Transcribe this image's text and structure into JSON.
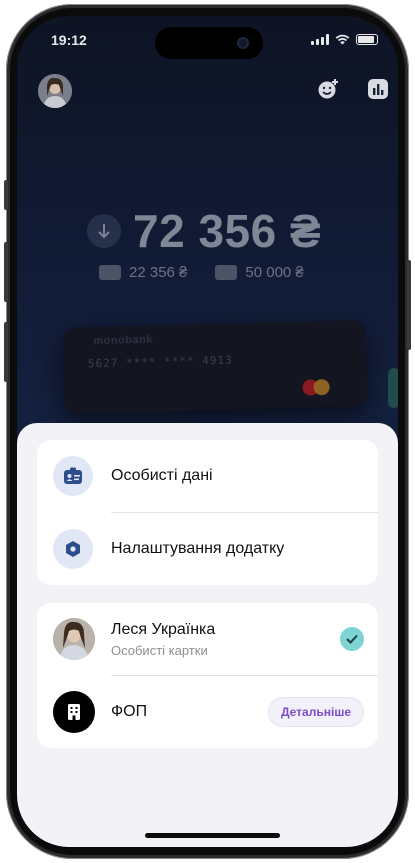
{
  "status_bar": {
    "time": "19:12"
  },
  "balance": {
    "amount": "72 356 ₴",
    "own_funds": "22 356 ₴",
    "credit_limit": "50 000 ₴"
  },
  "card": {
    "brand": "monobank",
    "number": "5627  ****  ****  4913"
  },
  "menu": {
    "personal_data": "Особисті дані",
    "app_settings": "Налаштування додатку"
  },
  "accounts": [
    {
      "name": "Леся Українка",
      "subtitle": "Особисті картки",
      "selected": true
    },
    {
      "name": "ФОП",
      "action_label": "Детальніше"
    }
  ],
  "colors": {
    "sheet_background": "#f2f2f7",
    "icon_accent": "#2e4d8f",
    "check_color": "#7fd4d3",
    "details_text": "#7c4cc9"
  }
}
